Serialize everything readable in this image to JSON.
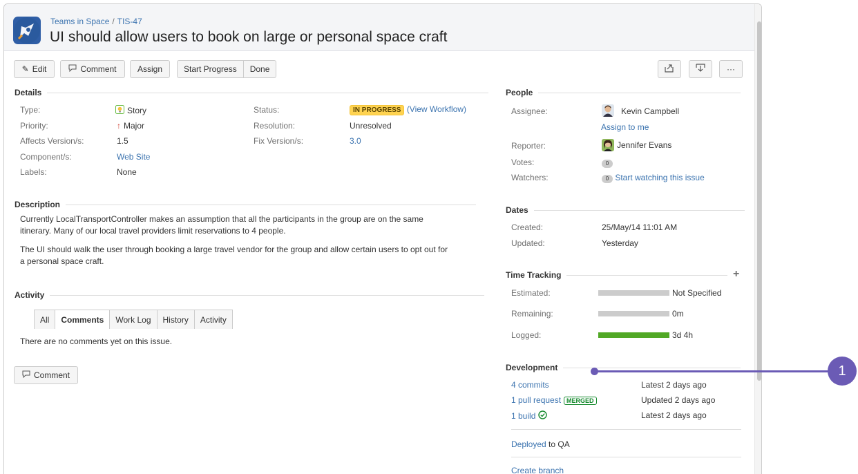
{
  "issue": {
    "project": "Teams in Space",
    "key": "TIS-47",
    "title": "UI should allow users to book on large or personal space craft"
  },
  "toolbar": {
    "edit": "Edit",
    "comment": "Comment",
    "assign": "Assign",
    "start_progress": "Start Progress",
    "done": "Done",
    "more": "···"
  },
  "details": {
    "heading": "Details",
    "type_label": "Type:",
    "type_value": "Story",
    "priority_label": "Priority:",
    "priority_value": "Major",
    "affects_label": "Affects Version/s:",
    "affects_value": "1.5",
    "component_label": "Component/s:",
    "component_value": "Web Site",
    "labels_label": "Labels:",
    "labels_value": "None",
    "status_label": "Status:",
    "status_value": "IN PROGRESS",
    "view_workflow": "(View Workflow)",
    "resolution_label": "Resolution:",
    "resolution_value": "Unresolved",
    "fix_label": "Fix Version/s:",
    "fix_value": "3.0"
  },
  "description": {
    "heading": "Description",
    "p1_line1": "Currently LocalTransportController makes an assumption that all the participants in the group are on the same",
    "p1_line2": "itinerary. Many of our local travel providers limit reservations to 4 people.",
    "p2_line1": "The UI should walk the user through booking a large travel vendor for the group and allow certain users to opt out for",
    "p2_line2": "a personal space craft."
  },
  "activity": {
    "heading": "Activity",
    "tabs": [
      "All",
      "Comments",
      "Work Log",
      "History",
      "Activity"
    ],
    "empty": "There are no comments yet on this issue.",
    "comment_button": "Comment"
  },
  "people": {
    "heading": "People",
    "assignee_label": "Assignee:",
    "assignee": "Kevin Campbell",
    "assign_to_me": "Assign to me",
    "reporter_label": "Reporter:",
    "reporter": "Jennifer Evans",
    "votes_label": "Votes:",
    "votes": "0",
    "watchers_label": "Watchers:",
    "watchers": "0",
    "watch_link": "Start watching this issue"
  },
  "dates": {
    "heading": "Dates",
    "created_label": "Created:",
    "created": "25/May/14 11:01 AM",
    "updated_label": "Updated:",
    "updated": "Yesterday"
  },
  "time_tracking": {
    "heading": "Time Tracking",
    "add": "+",
    "estimated_label": "Estimated:",
    "estimated": "Not Specified",
    "remaining_label": "Remaining:",
    "remaining": "0m",
    "logged_label": "Logged:",
    "logged": "3d 4h",
    "logged_fraction": 1.0
  },
  "development": {
    "heading": "Development",
    "commits_link": "4 commits",
    "commits_meta": "Latest 2 days ago",
    "pr_link": "1 pull request",
    "pr_badge": "MERGED",
    "pr_meta": "Updated 2 days ago",
    "build_link": "1 build",
    "build_meta": "Latest 2 days ago",
    "deployed_link": "Deployed",
    "deployed_rest": " to QA",
    "create_branch": "Create branch"
  },
  "callout": {
    "number": "1"
  },
  "colors": {
    "accent": "#3b73af",
    "in_progress": "#ffd351",
    "logged_bar": "#51a825",
    "callout": "#6b5bb5"
  }
}
